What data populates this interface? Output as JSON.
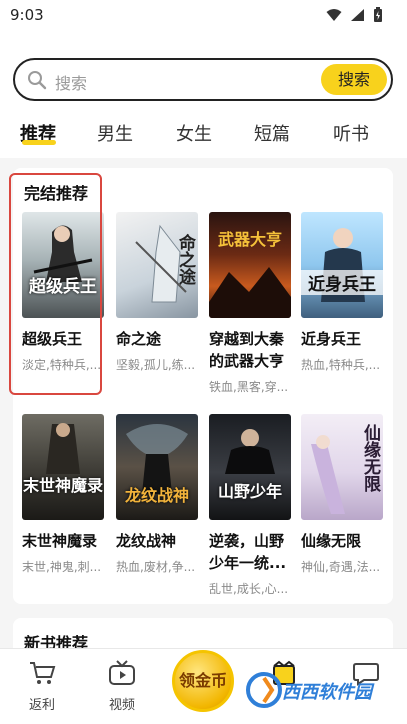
{
  "status_bar": {
    "time": "9:03"
  },
  "search": {
    "placeholder": "搜索",
    "button_label": "搜索"
  },
  "tabs": [
    {
      "label": "推荐",
      "active": true
    },
    {
      "label": "男生",
      "active": false
    },
    {
      "label": "女生",
      "active": false
    },
    {
      "label": "短篇",
      "active": false
    },
    {
      "label": "听书",
      "active": false
    }
  ],
  "sections": [
    {
      "title": "完结推荐",
      "books": [
        {
          "title": "超级兵王",
          "tags": "淡定,特种兵,...",
          "cover_text": "超级兵王"
        },
        {
          "title": "命之途",
          "tags": "坚毅,孤儿,练...",
          "cover_text": "命之途"
        },
        {
          "title": "穿越到大秦的武器大亨",
          "tags": "铁血,黑客,穿...",
          "cover_text": "武器大亨"
        },
        {
          "title": "近身兵王",
          "tags": "热血,特种兵,...",
          "cover_text": "近身兵王"
        },
        {
          "title": "末世神魔录",
          "tags": "末世,神鬼,刺...",
          "cover_text": "末世神魔录"
        },
        {
          "title": "龙纹战神",
          "tags": "热血,废材,争...",
          "cover_text": "龙纹战神"
        },
        {
          "title": "逆袭，山野少年一统...",
          "tags": "乱世,成长,心...",
          "cover_text": "山野少年"
        },
        {
          "title": "仙缘无限",
          "tags": "神仙,奇遇,法...",
          "cover_text": "仙缘无限"
        }
      ]
    },
    {
      "title": "新书推荐"
    }
  ],
  "bottom_nav": {
    "items": [
      {
        "label": "返利",
        "icon": "cart-icon"
      },
      {
        "label": "视频",
        "icon": "tv-icon"
      },
      {
        "label": "领金币",
        "icon": "coin-icon"
      },
      {
        "label": "",
        "icon": "bookshelf-icon"
      },
      {
        "label": "",
        "icon": "chat-icon"
      }
    ]
  },
  "watermark": {
    "text": "西西软件园"
  },
  "colors": {
    "accent": "#f8d21c",
    "highlight": "#d9473f"
  }
}
